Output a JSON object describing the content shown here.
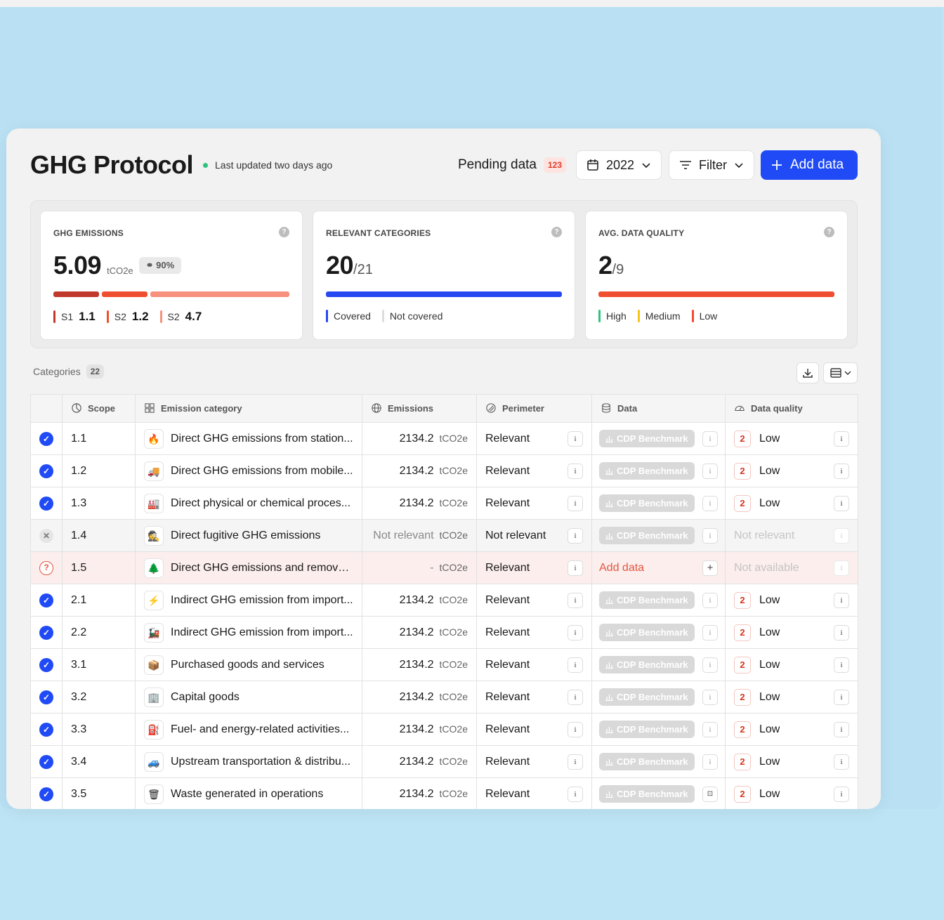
{
  "header": {
    "title": "GHG Protocol",
    "updated": "Last updated two days ago",
    "pending_label": "Pending data",
    "pending_count": "123",
    "year": "2022",
    "filter_label": "Filter",
    "add_label": "Add data"
  },
  "kpis": {
    "emissions": {
      "label": "GHG EMISSIONS",
      "value": "5.09",
      "unit": "tCO2e",
      "pct": "90%",
      "legend": [
        {
          "label": "S1",
          "value": "1.1",
          "color": "#c0392b"
        },
        {
          "label": "S2",
          "value": "1.2",
          "color": "#f04e30"
        },
        {
          "label": "S2",
          "value": "4.7",
          "color": "#f7917e"
        }
      ]
    },
    "categories": {
      "label": "RELEVANT CATEGORIES",
      "value": "20",
      "total": "/21",
      "legend": [
        {
          "label": "Covered",
          "color": "#2548f0"
        },
        {
          "label": "Not covered",
          "color": "#dddddd"
        }
      ]
    },
    "quality": {
      "label": "AVG. DATA QUALITY",
      "value": "2",
      "total": "/9",
      "legend": [
        {
          "label": "High",
          "color": "#2ec27e"
        },
        {
          "label": "Medium",
          "color": "#f5c518"
        },
        {
          "label": "Low",
          "color": "#f04e30"
        }
      ]
    }
  },
  "categories_label": "Categories",
  "categories_count": "22",
  "columns": {
    "scope": "Scope",
    "category": "Emission category",
    "emissions": "Emissions",
    "perimeter": "Perimeter",
    "data": "Data",
    "quality": "Data quality"
  },
  "rows": [
    {
      "status": "check",
      "scope": "1.1",
      "icon": "🔥",
      "category": "Direct GHG emissions from station...",
      "emissions": "2134.2",
      "unit": "tCO2e",
      "perimeter": "Relevant",
      "data": "CDP Benchmark",
      "q_num": "2",
      "quality": "Low"
    },
    {
      "status": "check",
      "scope": "1.2",
      "icon": "🚚",
      "category": "Direct GHG emissions from mobile...",
      "emissions": "2134.2",
      "unit": "tCO2e",
      "perimeter": "Relevant",
      "data": "CDP Benchmark",
      "q_num": "2",
      "quality": "Low"
    },
    {
      "status": "check",
      "scope": "1.3",
      "icon": "🏭",
      "category": "Direct physical or chemical proces...",
      "emissions": "2134.2",
      "unit": "tCO2e",
      "perimeter": "Relevant",
      "data": "CDP Benchmark",
      "q_num": "2",
      "quality": "Low"
    },
    {
      "status": "x",
      "scope": "1.4",
      "icon": "🕵",
      "category": "Direct fugitive GHG emissions",
      "emissions": "Not relevant",
      "unit": "tCO2e",
      "perimeter": "Not relevant",
      "data": "CDP Benchmark",
      "q_num": "",
      "quality": "Not relevant"
    },
    {
      "status": "q",
      "scope": "1.5",
      "icon": "🌲",
      "category": "Direct GHG emissions and removal...",
      "emissions": "-",
      "unit": "tCO2e",
      "perimeter": "Relevant",
      "data": "Add data",
      "q_num": "",
      "quality": "Not available"
    },
    {
      "status": "check",
      "scope": "2.1",
      "icon": "⚡",
      "category": "Indirect GHG emission from import...",
      "emissions": "2134.2",
      "unit": "tCO2e",
      "perimeter": "Relevant",
      "data": "CDP Benchmark",
      "q_num": "2",
      "quality": "Low"
    },
    {
      "status": "check",
      "scope": "2.2",
      "icon": "🚂",
      "category": "Indirect GHG emission from import...",
      "emissions": "2134.2",
      "unit": "tCO2e",
      "perimeter": "Relevant",
      "data": "CDP Benchmark",
      "q_num": "2",
      "quality": "Low"
    },
    {
      "status": "check",
      "scope": "3.1",
      "icon": "📦",
      "category": "Purchased goods and services",
      "emissions": "2134.2",
      "unit": "tCO2e",
      "perimeter": "Relevant",
      "data": "CDP Benchmark",
      "q_num": "2",
      "quality": "Low"
    },
    {
      "status": "check",
      "scope": "3.2",
      "icon": "🏢",
      "category": "Capital goods",
      "emissions": "2134.2",
      "unit": "tCO2e",
      "perimeter": "Relevant",
      "data": "CDP Benchmark",
      "q_num": "2",
      "quality": "Low"
    },
    {
      "status": "check",
      "scope": "3.3",
      "icon": "⛽",
      "category": "Fuel- and energy-related activities...",
      "emissions": "2134.2",
      "unit": "tCO2e",
      "perimeter": "Relevant",
      "data": "CDP Benchmark",
      "q_num": "2",
      "quality": "Low"
    },
    {
      "status": "check",
      "scope": "3.4",
      "icon": "🚙",
      "category": "Upstream transportation & distribu...",
      "emissions": "2134.2",
      "unit": "tCO2e",
      "perimeter": "Relevant",
      "data": "CDP Benchmark",
      "q_num": "2",
      "quality": "Low"
    },
    {
      "status": "check",
      "scope": "3.5",
      "icon": "🗑",
      "category": "Waste generated in operations",
      "emissions": "2134.2",
      "unit": "tCO2e",
      "perimeter": "Relevant",
      "data": "CDP Benchmark",
      "q_num": "2",
      "quality": "Low"
    }
  ]
}
